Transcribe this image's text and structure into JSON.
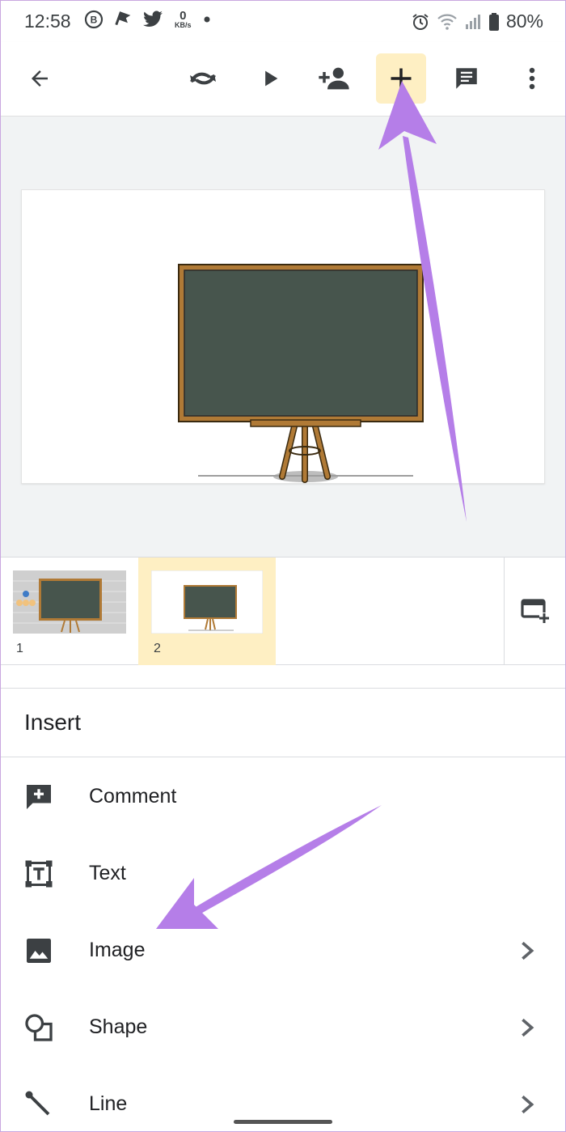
{
  "status_bar": {
    "time": "12:58",
    "speed_value": "0",
    "speed_unit": "KB/s",
    "battery": "80%",
    "icons": [
      "b-badge-icon",
      "flag-icon",
      "twitter-icon",
      "dot-icon",
      "alarm-icon",
      "wifi-icon",
      "signal-icon",
      "battery-icon"
    ]
  },
  "toolbar": {
    "icons": [
      "back-arrow-icon",
      "undo-icon",
      "play-icon",
      "add-person-icon",
      "plus-icon",
      "comment-icon",
      "more-vert-icon"
    ],
    "active_color": "#feefc3"
  },
  "filmstrip": {
    "slides": [
      {
        "number": "1",
        "selected": false
      },
      {
        "number": "2",
        "selected": true
      }
    ]
  },
  "insert_menu": {
    "title": "Insert",
    "items": [
      {
        "label": "Comment",
        "icon": "add-comment-icon",
        "has_submenu": false
      },
      {
        "label": "Text",
        "icon": "text-box-icon",
        "has_submenu": false
      },
      {
        "label": "Image",
        "icon": "image-icon",
        "has_submenu": true
      },
      {
        "label": "Shape",
        "icon": "shape-icon",
        "has_submenu": true
      },
      {
        "label": "Line",
        "icon": "line-icon",
        "has_submenu": true
      }
    ]
  },
  "colors": {
    "chalkboard": "#47554d",
    "frame": "#b07a36",
    "highlight": "#feefc3",
    "annotation_arrow": "#b57ee8"
  }
}
